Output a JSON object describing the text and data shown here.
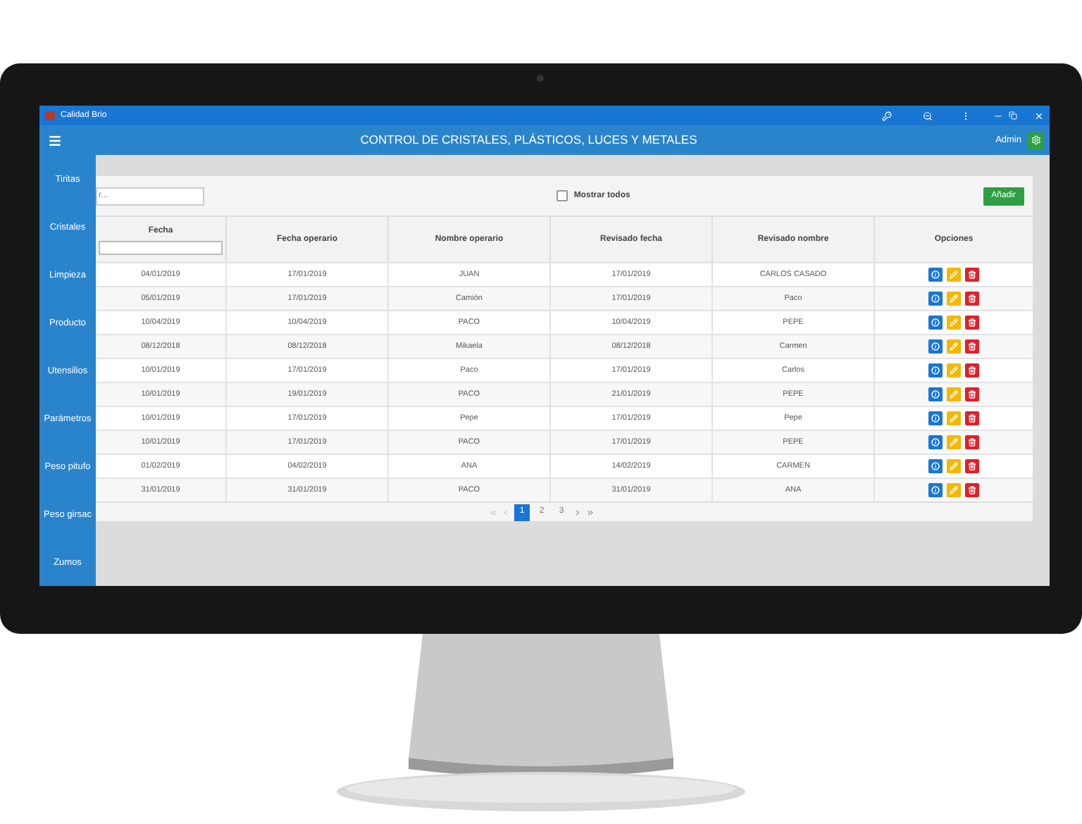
{
  "window": {
    "title": "Calidad Brio"
  },
  "header": {
    "title": "CONTROL DE CRISTALES, PLÁSTICOS, LUCES Y METALES",
    "user": "Admin"
  },
  "sidebar": {
    "items": [
      {
        "label": "Tiritas"
      },
      {
        "label": "Cristales"
      },
      {
        "label": "Limpieza"
      },
      {
        "label": "Producto"
      },
      {
        "label": "Utensilios"
      },
      {
        "label": "Parámetros"
      },
      {
        "label": "Peso pitufo"
      },
      {
        "label": "Peso girsac"
      },
      {
        "label": "Zumos"
      }
    ]
  },
  "toolbar": {
    "search": {
      "placeholder": "r..."
    },
    "show_all": {
      "label": "Mostrar todos",
      "checked": false
    },
    "add_button": "Añadir"
  },
  "table": {
    "columns": [
      "Fecha",
      "Fecha operario",
      "Nombre operario",
      "Revisado fecha",
      "Revisado nombre",
      "Opciones"
    ],
    "rows": [
      {
        "fecha": "04/01/2019",
        "fecha_operario": "17/01/2019",
        "nombre_operario": "JUAN",
        "revisado_fecha": "17/01/2019",
        "revisado_nombre": "CARLOS CASADO"
      },
      {
        "fecha": "05/01/2019",
        "fecha_operario": "17/01/2019",
        "nombre_operario": "Camión",
        "revisado_fecha": "17/01/2019",
        "revisado_nombre": "Paco"
      },
      {
        "fecha": "10/04/2019",
        "fecha_operario": "10/04/2019",
        "nombre_operario": "PACO",
        "revisado_fecha": "10/04/2019",
        "revisado_nombre": "PEPE"
      },
      {
        "fecha": "08/12/2018",
        "fecha_operario": "08/12/2018",
        "nombre_operario": "Mikaela",
        "revisado_fecha": "08/12/2018",
        "revisado_nombre": "Carmen"
      },
      {
        "fecha": "10/01/2019",
        "fecha_operario": "17/01/2019",
        "nombre_operario": "Paco",
        "revisado_fecha": "17/01/2019",
        "revisado_nombre": "Carlos"
      },
      {
        "fecha": "10/01/2019",
        "fecha_operario": "19/01/2019",
        "nombre_operario": "PACO",
        "revisado_fecha": "21/01/2019",
        "revisado_nombre": "PEPE"
      },
      {
        "fecha": "10/01/2019",
        "fecha_operario": "17/01/2019",
        "nombre_operario": "Pepe",
        "revisado_fecha": "17/01/2019",
        "revisado_nombre": "Pepe"
      },
      {
        "fecha": "10/01/2019",
        "fecha_operario": "17/01/2019",
        "nombre_operario": "PACO",
        "revisado_fecha": "17/01/2019",
        "revisado_nombre": "PEPE"
      },
      {
        "fecha": "01/02/2019",
        "fecha_operario": "04/02/2019",
        "nombre_operario": "ANA",
        "revisado_fecha": "14/02/2019",
        "revisado_nombre": "CARMEN"
      },
      {
        "fecha": "31/01/2019",
        "fecha_operario": "31/01/2019",
        "nombre_operario": "PACO",
        "revisado_fecha": "31/01/2019",
        "revisado_nombre": "ANA"
      }
    ]
  },
  "pagination": {
    "pages": [
      {
        "label": "1",
        "selected": true
      },
      {
        "label": "2",
        "selected": false
      },
      {
        "label": "3",
        "selected": false
      }
    ]
  }
}
